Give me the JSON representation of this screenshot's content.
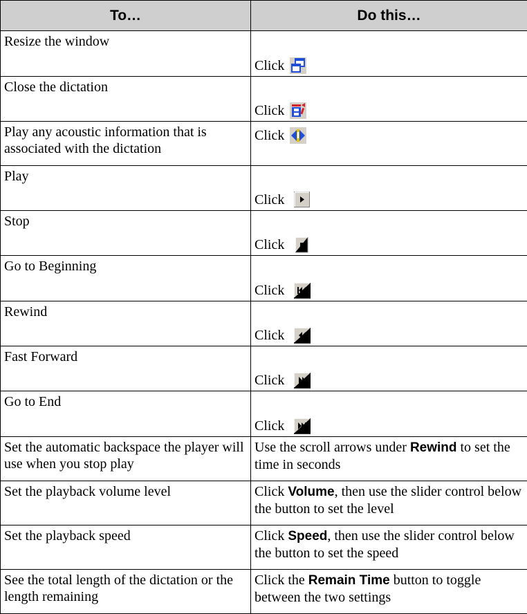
{
  "table": {
    "header": {
      "col1": "To…",
      "col2": "Do this…"
    },
    "icon_rows": [
      {
        "task": "Resize the window",
        "click": "Click",
        "icon": "resize-window-icon"
      },
      {
        "task": "Close the dictation",
        "click": "Click",
        "icon": "close-dictation-icon"
      },
      {
        "task": "Play any acoustic information that is associated with the dictation",
        "click": "Click",
        "icon": "play-acoustic-icon"
      },
      {
        "task": "Play",
        "click": "Click",
        "icon": "play-icon"
      },
      {
        "task": "Stop",
        "click": "Click",
        "icon": "stop-icon"
      },
      {
        "task": "Go to Beginning",
        "click": "Click",
        "icon": "go-to-beginning-icon"
      },
      {
        "task": "Rewind",
        "click": "Click",
        "icon": "rewind-icon"
      },
      {
        "task": "Fast Forward",
        "click": "Click",
        "icon": "fast-forward-icon"
      },
      {
        "task": "Go to End",
        "click": "Click",
        "icon": "go-to-end-icon"
      }
    ],
    "text_rows": [
      {
        "task": "Set the automatic backspace the player will use when you stop play",
        "pre": "Use the scroll arrows under ",
        "bold": "Rewind",
        "post": " to set the time in seconds"
      },
      {
        "task": "Set the playback volume level",
        "pre": "Click ",
        "bold": "Volume",
        "post": ", then use the slider control below the button to set the level"
      },
      {
        "task": "Set the playback speed",
        "pre": "Click ",
        "bold": "Speed",
        "post": ", then use the slider control below the button to set the speed"
      },
      {
        "task": "See the total length of the dictation or the length remaining",
        "pre": "Click the ",
        "bold": "Remain Time",
        "post": " button to toggle between the two settings"
      }
    ],
    "colors": {
      "header_bg": "#cfcfcf",
      "icon_blue": "#1f4fd8",
      "icon_red": "#d8202a",
      "icon_yellow": "#e8c400",
      "button_face": "#d4d0c8"
    }
  }
}
